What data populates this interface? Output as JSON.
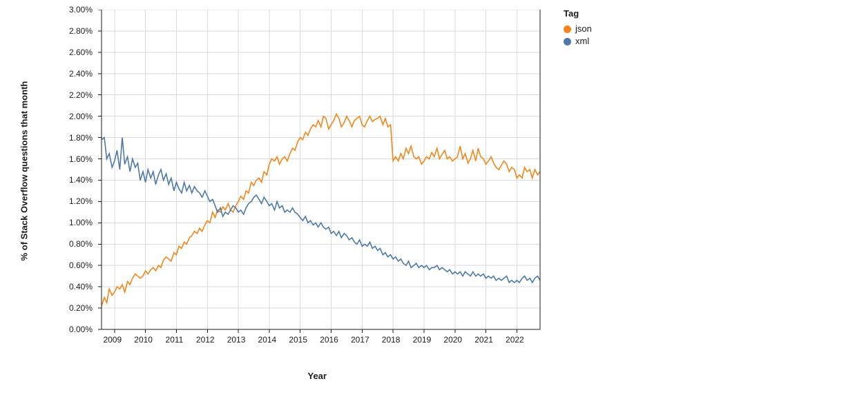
{
  "chart_data": {
    "type": "line",
    "title": "",
    "xlabel": "Year",
    "ylabel": "% of Stack Overflow questions that month",
    "legend_title": "Tag",
    "ylim": [
      0,
      3.0
    ],
    "yticks": [
      0.0,
      0.2,
      0.4,
      0.6,
      0.8,
      1.0,
      1.2,
      1.4,
      1.6,
      1.8,
      2.0,
      2.2,
      2.4,
      2.6,
      2.8,
      3.0
    ],
    "ytick_labels": [
      "0.00%",
      "0.20%",
      "0.40%",
      "0.60%",
      "0.80%",
      "1.00%",
      "1.20%",
      "1.40%",
      "1.60%",
      "1.80%",
      "2.00%",
      "2.20%",
      "2.40%",
      "2.60%",
      "2.80%",
      "3.00%"
    ],
    "x_year_ticks": [
      2009,
      2010,
      2011,
      2012,
      2013,
      2014,
      2015,
      2016,
      2017,
      2018,
      2019,
      2020,
      2021,
      2022
    ],
    "xlim": [
      2008.58,
      2022.75
    ],
    "colors": {
      "json": "#f58518",
      "xml": "#4c78a8"
    },
    "series": [
      {
        "name": "json",
        "color": "#f58518",
        "x": [
          2008.58,
          2008.67,
          2008.75,
          2008.83,
          2008.92,
          2009.0,
          2009.08,
          2009.17,
          2009.25,
          2009.33,
          2009.42,
          2009.5,
          2009.58,
          2009.67,
          2009.75,
          2009.83,
          2009.92,
          2010.0,
          2010.08,
          2010.17,
          2010.25,
          2010.33,
          2010.42,
          2010.5,
          2010.58,
          2010.67,
          2010.75,
          2010.83,
          2010.92,
          2011.0,
          2011.08,
          2011.17,
          2011.25,
          2011.33,
          2011.42,
          2011.5,
          2011.58,
          2011.67,
          2011.75,
          2011.83,
          2011.92,
          2012.0,
          2012.08,
          2012.17,
          2012.25,
          2012.33,
          2012.42,
          2012.5,
          2012.58,
          2012.67,
          2012.75,
          2012.83,
          2012.92,
          2013.0,
          2013.08,
          2013.17,
          2013.25,
          2013.33,
          2013.42,
          2013.5,
          2013.58,
          2013.67,
          2013.75,
          2013.83,
          2013.92,
          2014.0,
          2014.08,
          2014.17,
          2014.25,
          2014.33,
          2014.42,
          2014.5,
          2014.58,
          2014.67,
          2014.75,
          2014.83,
          2014.92,
          2015.0,
          2015.08,
          2015.17,
          2015.25,
          2015.33,
          2015.42,
          2015.5,
          2015.58,
          2015.67,
          2015.75,
          2015.83,
          2015.92,
          2016.0,
          2016.08,
          2016.17,
          2016.25,
          2016.33,
          2016.42,
          2016.5,
          2016.58,
          2016.67,
          2016.75,
          2016.83,
          2016.92,
          2017.0,
          2017.08,
          2017.17,
          2017.25,
          2017.33,
          2017.42,
          2017.5,
          2017.58,
          2017.67,
          2017.75,
          2017.83,
          2017.92,
          2018.0,
          2018.08,
          2018.17,
          2018.25,
          2018.33,
          2018.42,
          2018.5,
          2018.58,
          2018.67,
          2018.75,
          2018.83,
          2018.92,
          2019.0,
          2019.08,
          2019.17,
          2019.25,
          2019.33,
          2019.42,
          2019.5,
          2019.58,
          2019.67,
          2019.75,
          2019.83,
          2019.92,
          2020.0,
          2020.08,
          2020.17,
          2020.25,
          2020.33,
          2020.42,
          2020.5,
          2020.58,
          2020.67,
          2020.75,
          2020.83,
          2020.92,
          2021.0,
          2021.08,
          2021.17,
          2021.25,
          2021.33,
          2021.42,
          2021.5,
          2021.58,
          2021.67,
          2021.75,
          2021.83,
          2021.92,
          2022.0,
          2022.08,
          2022.17,
          2022.25,
          2022.33,
          2022.42,
          2022.5,
          2022.58,
          2022.67,
          2022.75
        ],
        "values": [
          0.22,
          0.3,
          0.25,
          0.38,
          0.32,
          0.35,
          0.4,
          0.38,
          0.42,
          0.35,
          0.45,
          0.42,
          0.48,
          0.52,
          0.5,
          0.48,
          0.5,
          0.55,
          0.52,
          0.56,
          0.58,
          0.55,
          0.6,
          0.58,
          0.65,
          0.68,
          0.66,
          0.64,
          0.72,
          0.7,
          0.78,
          0.76,
          0.82,
          0.8,
          0.86,
          0.88,
          0.92,
          0.9,
          0.95,
          0.92,
          0.98,
          1.02,
          1.0,
          1.1,
          1.05,
          1.12,
          1.1,
          1.15,
          1.12,
          1.18,
          1.12,
          1.1,
          1.16,
          1.2,
          1.25,
          1.22,
          1.3,
          1.28,
          1.38,
          1.35,
          1.4,
          1.42,
          1.38,
          1.48,
          1.45,
          1.55,
          1.6,
          1.58,
          1.62,
          1.55,
          1.6,
          1.62,
          1.58,
          1.65,
          1.7,
          1.68,
          1.76,
          1.8,
          1.78,
          1.85,
          1.82,
          1.88,
          1.92,
          1.9,
          1.96,
          1.9,
          2.0,
          1.98,
          1.88,
          1.92,
          1.96,
          2.02,
          1.98,
          1.9,
          1.94,
          2.0,
          1.96,
          1.9,
          1.96,
          1.98,
          2.0,
          1.92,
          1.9,
          1.96,
          2.0,
          1.95,
          1.97,
          1.98,
          2.0,
          1.92,
          1.98,
          1.9,
          1.92,
          1.58,
          1.62,
          1.58,
          1.65,
          1.6,
          1.7,
          1.65,
          1.72,
          1.62,
          1.6,
          1.62,
          1.55,
          1.58,
          1.62,
          1.6,
          1.66,
          1.62,
          1.7,
          1.6,
          1.64,
          1.68,
          1.6,
          1.62,
          1.58,
          1.6,
          1.62,
          1.72,
          1.6,
          1.65,
          1.56,
          1.6,
          1.68,
          1.58,
          1.7,
          1.62,
          1.6,
          1.55,
          1.58,
          1.62,
          1.56,
          1.52,
          1.5,
          1.54,
          1.58,
          1.55,
          1.48,
          1.52,
          1.5,
          1.42,
          1.45,
          1.42,
          1.52,
          1.48,
          1.5,
          1.42,
          1.5,
          1.45,
          1.48
        ]
      },
      {
        "name": "xml",
        "color": "#4c78a8",
        "x": [
          2008.58,
          2008.67,
          2008.75,
          2008.83,
          2008.92,
          2009.0,
          2009.08,
          2009.17,
          2009.25,
          2009.33,
          2009.42,
          2009.5,
          2009.58,
          2009.67,
          2009.75,
          2009.83,
          2009.92,
          2010.0,
          2010.08,
          2010.17,
          2010.25,
          2010.33,
          2010.42,
          2010.5,
          2010.58,
          2010.67,
          2010.75,
          2010.83,
          2010.92,
          2011.0,
          2011.08,
          2011.17,
          2011.25,
          2011.33,
          2011.42,
          2011.5,
          2011.58,
          2011.67,
          2011.75,
          2011.83,
          2011.92,
          2012.0,
          2012.08,
          2012.17,
          2012.25,
          2012.33,
          2012.42,
          2012.5,
          2012.58,
          2012.67,
          2012.75,
          2012.83,
          2012.92,
          2013.0,
          2013.08,
          2013.17,
          2013.25,
          2013.33,
          2013.42,
          2013.5,
          2013.58,
          2013.67,
          2013.75,
          2013.83,
          2013.92,
          2014.0,
          2014.08,
          2014.17,
          2014.25,
          2014.33,
          2014.42,
          2014.5,
          2014.58,
          2014.67,
          2014.75,
          2014.83,
          2014.92,
          2015.0,
          2015.08,
          2015.17,
          2015.25,
          2015.33,
          2015.42,
          2015.5,
          2015.58,
          2015.67,
          2015.75,
          2015.83,
          2015.92,
          2016.0,
          2016.08,
          2016.17,
          2016.25,
          2016.33,
          2016.42,
          2016.5,
          2016.58,
          2016.67,
          2016.75,
          2016.83,
          2016.92,
          2017.0,
          2017.08,
          2017.17,
          2017.25,
          2017.33,
          2017.42,
          2017.5,
          2017.58,
          2017.67,
          2017.75,
          2017.83,
          2017.92,
          2018.0,
          2018.08,
          2018.17,
          2018.25,
          2018.33,
          2018.42,
          2018.5,
          2018.58,
          2018.67,
          2018.75,
          2018.83,
          2018.92,
          2019.0,
          2019.08,
          2019.17,
          2019.25,
          2019.33,
          2019.42,
          2019.5,
          2019.58,
          2019.67,
          2019.75,
          2019.83,
          2019.92,
          2020.0,
          2020.08,
          2020.17,
          2020.25,
          2020.33,
          2020.42,
          2020.5,
          2020.58,
          2020.67,
          2020.75,
          2020.83,
          2020.92,
          2021.0,
          2021.08,
          2021.17,
          2021.25,
          2021.33,
          2021.42,
          2021.5,
          2021.58,
          2021.67,
          2021.75,
          2021.83,
          2021.92,
          2022.0,
          2022.08,
          2022.17,
          2022.25,
          2022.33,
          2022.42,
          2022.5,
          2022.58,
          2022.67,
          2022.75
        ],
        "values": [
          1.78,
          1.8,
          1.6,
          1.65,
          1.52,
          1.58,
          1.68,
          1.5,
          1.8,
          1.55,
          1.62,
          1.48,
          1.6,
          1.52,
          1.56,
          1.4,
          1.48,
          1.38,
          1.5,
          1.42,
          1.48,
          1.36,
          1.45,
          1.5,
          1.4,
          1.46,
          1.36,
          1.42,
          1.3,
          1.38,
          1.32,
          1.28,
          1.38,
          1.3,
          1.35,
          1.28,
          1.34,
          1.3,
          1.28,
          1.24,
          1.3,
          1.25,
          1.2,
          1.22,
          1.16,
          1.1,
          1.14,
          1.06,
          1.1,
          1.08,
          1.12,
          1.16,
          1.14,
          1.1,
          1.12,
          1.08,
          1.14,
          1.18,
          1.2,
          1.24,
          1.26,
          1.22,
          1.18,
          1.24,
          1.2,
          1.16,
          1.18,
          1.12,
          1.2,
          1.14,
          1.16,
          1.1,
          1.12,
          1.1,
          1.14,
          1.1,
          1.08,
          1.05,
          1.02,
          1.06,
          1.0,
          1.02,
          0.98,
          1.0,
          0.96,
          1.0,
          0.96,
          0.94,
          0.96,
          0.9,
          0.92,
          0.88,
          0.92,
          0.86,
          0.9,
          0.88,
          0.84,
          0.86,
          0.82,
          0.8,
          0.84,
          0.78,
          0.8,
          0.78,
          0.82,
          0.76,
          0.78,
          0.74,
          0.76,
          0.7,
          0.72,
          0.68,
          0.7,
          0.66,
          0.68,
          0.64,
          0.66,
          0.62,
          0.6,
          0.64,
          0.58,
          0.6,
          0.62,
          0.58,
          0.6,
          0.58,
          0.6,
          0.56,
          0.58,
          0.58,
          0.6,
          0.56,
          0.58,
          0.56,
          0.54,
          0.56,
          0.52,
          0.54,
          0.52,
          0.54,
          0.5,
          0.54,
          0.52,
          0.5,
          0.54,
          0.5,
          0.52,
          0.5,
          0.52,
          0.48,
          0.5,
          0.48,
          0.5,
          0.46,
          0.48,
          0.46,
          0.48,
          0.5,
          0.44,
          0.46,
          0.44,
          0.46,
          0.44,
          0.48,
          0.5,
          0.46,
          0.48,
          0.44,
          0.48,
          0.5,
          0.46
        ]
      }
    ]
  }
}
